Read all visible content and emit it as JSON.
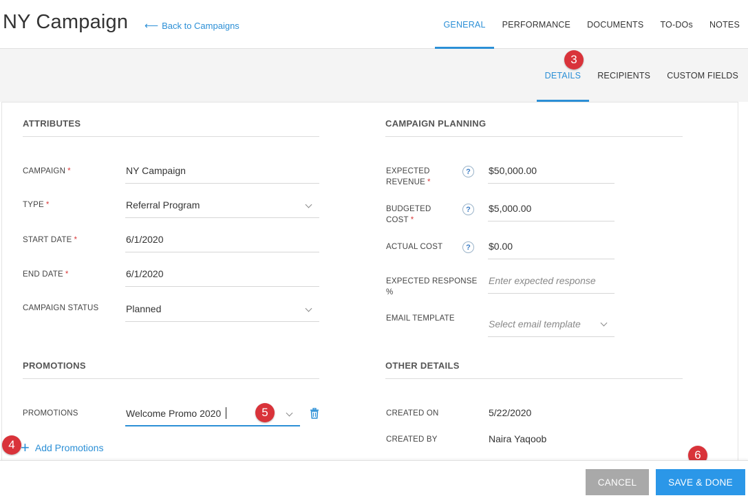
{
  "header": {
    "title": "NY Campaign",
    "back_label": "Back to Campaigns",
    "tabs": [
      {
        "label": "GENERAL",
        "active": true
      },
      {
        "label": "PERFORMANCE",
        "active": false
      },
      {
        "label": "DOCUMENTS",
        "active": false
      },
      {
        "label": "TO-DOs",
        "active": false
      },
      {
        "label": "NOTES",
        "active": false
      }
    ]
  },
  "subtabs": [
    {
      "label": "DETAILS",
      "active": true
    },
    {
      "label": "RECIPIENTS",
      "active": false
    },
    {
      "label": "CUSTOM FIELDS",
      "active": false
    }
  ],
  "attributes": {
    "title": "ATTRIBUTES",
    "campaign": {
      "label": "CAMPAIGN",
      "value": "NY Campaign"
    },
    "type": {
      "label": "TYPE",
      "value": "Referral Program"
    },
    "start_date": {
      "label": "START DATE",
      "value": "6/1/2020"
    },
    "end_date": {
      "label": "END DATE",
      "value": "6/1/2020"
    },
    "status": {
      "label": "CAMPAIGN STATUS",
      "value": "Planned"
    }
  },
  "planning": {
    "title": "CAMPAIGN PLANNING",
    "expected_revenue": {
      "label_line1": "EXPECTED",
      "label_line2": "REVENUE",
      "value": "$50,000.00"
    },
    "budgeted_cost": {
      "label_line1": "BUDGETED",
      "label_line2": "COST",
      "value": "$5,000.00"
    },
    "actual_cost": {
      "label": "ACTUAL COST",
      "value": "$0.00"
    },
    "expected_response": {
      "label_line1": "EXPECTED RESPONSE",
      "label_line2": "%",
      "placeholder": "Enter expected response"
    },
    "email_template": {
      "label": "EMAIL TEMPLATE",
      "placeholder": "Select email template"
    }
  },
  "promotions": {
    "title": "PROMOTIONS",
    "label": "PROMOTIONS",
    "value": "Welcome Promo 2020",
    "add_label": "Add Promotions"
  },
  "other": {
    "title": "OTHER DETAILS",
    "created_on": {
      "label": "CREATED ON",
      "value": "5/22/2020"
    },
    "created_by": {
      "label": "CREATED BY",
      "value": "Naira Yaqoob"
    }
  },
  "badges": {
    "b3": "3",
    "b4": "4",
    "b5": "5",
    "b6": "6"
  },
  "footer": {
    "cancel_label": "CANCEL",
    "save_label": "SAVE & DONE"
  },
  "colors": {
    "accent": "#2b8fd6",
    "required": "#d93a3a",
    "badge": "#d9333a"
  },
  "icons": {
    "back": "arrow-left-icon",
    "help": "help-circle-icon",
    "delete": "trash-icon",
    "add": "plus-icon",
    "dropdown": "chevron-down-icon"
  }
}
